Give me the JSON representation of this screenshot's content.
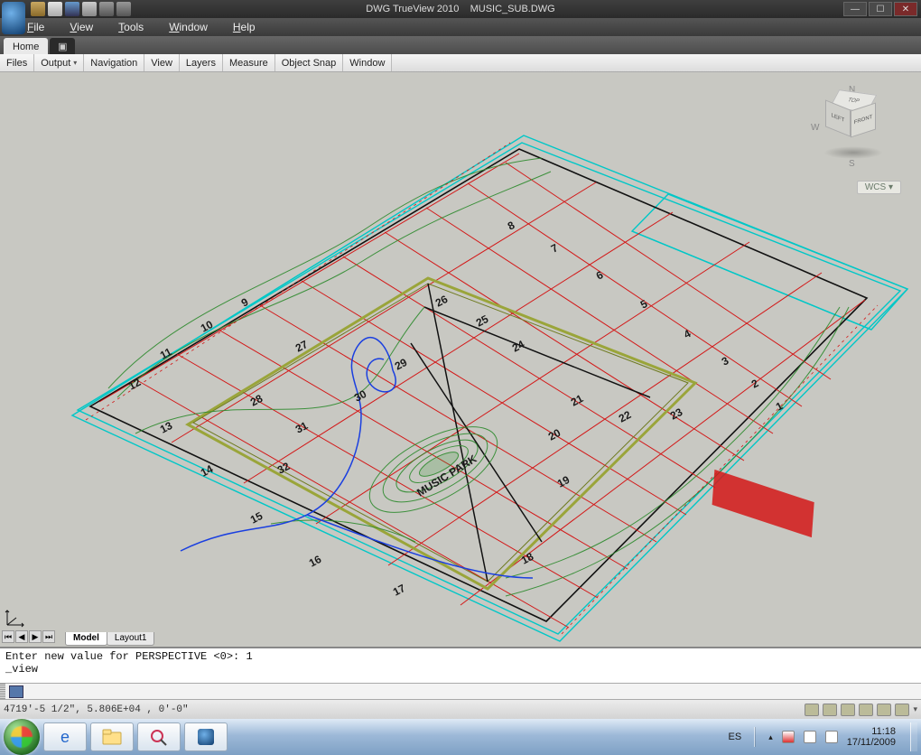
{
  "title": {
    "app": "DWG TrueView 2010",
    "file": "MUSIC_SUB.DWG"
  },
  "menus": {
    "file": "File",
    "view": "View",
    "tools": "Tools",
    "window": "Window",
    "help": "Help"
  },
  "tabs": {
    "home": "Home"
  },
  "ribbon": {
    "files": "Files",
    "output": "Output",
    "navigation": "Navigation",
    "view": "View",
    "layers": "Layers",
    "measure": "Measure",
    "osnap": "Object Snap",
    "window": "Window"
  },
  "viewcube": {
    "top": "TOP",
    "left": "LEFT",
    "front": "FRONT",
    "n": "N",
    "w": "W",
    "s": "S"
  },
  "wcs": "WCS ▾",
  "layout_tabs": {
    "model": "Model",
    "layout1": "Layout1"
  },
  "drawing": {
    "center_label": "MUSIC PARK",
    "lots": [
      "1",
      "2",
      "3",
      "4",
      "5",
      "6",
      "7",
      "8",
      "9",
      "10",
      "11",
      "12",
      "13",
      "14",
      "15",
      "16",
      "17",
      "18",
      "19",
      "20",
      "21",
      "22",
      "23",
      "24",
      "25",
      "26",
      "27",
      "28",
      "29",
      "30",
      "31",
      "32"
    ]
  },
  "command": {
    "line1": "Enter new value for PERSPECTIVE <0>: 1",
    "line2": "_view",
    "prompt": ""
  },
  "status": {
    "coords": "4719'-5 1/2\", 5.806E+04 , 0'-0\""
  },
  "tray": {
    "lang": "ES",
    "time": "11:18",
    "date": "17/11/2009",
    "chevron": "▴"
  }
}
